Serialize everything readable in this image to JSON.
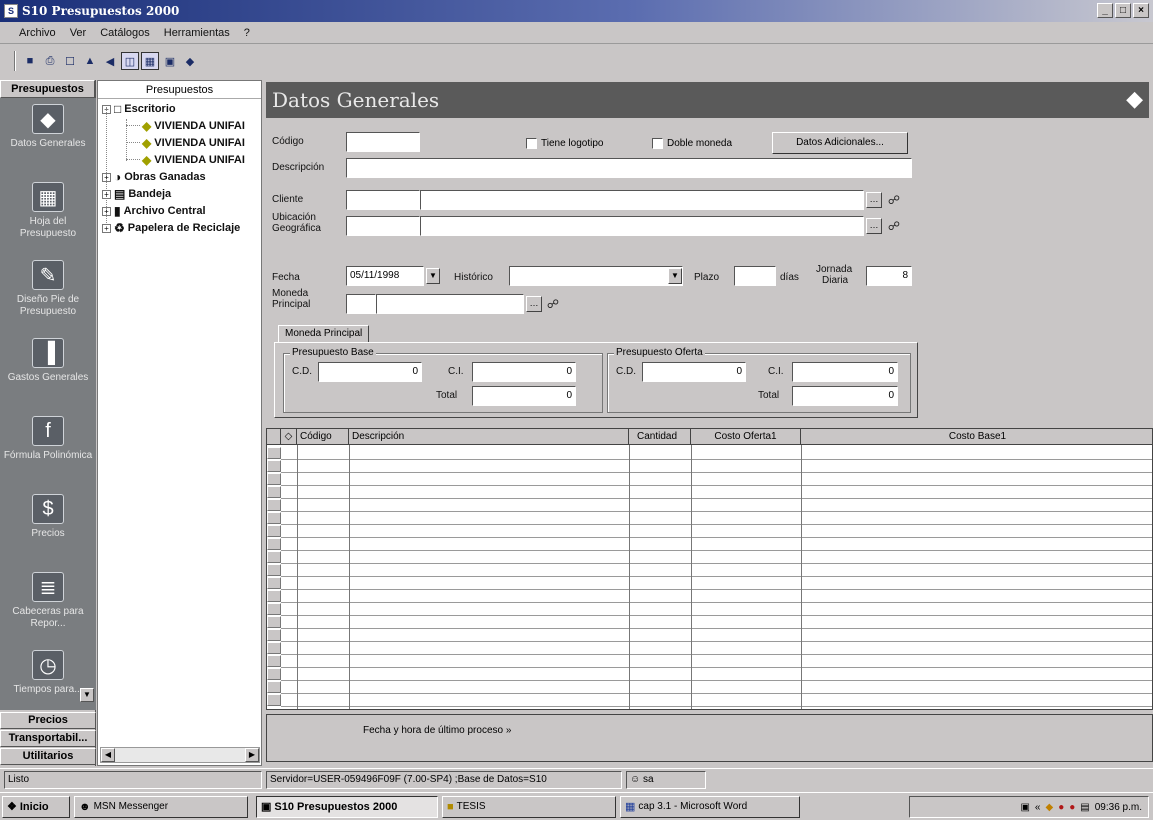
{
  "window": {
    "title": "S10 Presupuestos 2000",
    "controls": [
      "_",
      "□",
      "×"
    ]
  },
  "menu": [
    "Archivo",
    "Ver",
    "Catálogos",
    "Herramientas",
    "?"
  ],
  "outlook": {
    "header": "Presupuestos",
    "items": [
      {
        "label": "Datos Generales",
        "icon": "tag-icon",
        "glyph": "◆"
      },
      {
        "label": "Hoja del Presupuesto",
        "icon": "worksheet-icon",
        "glyph": "▦"
      },
      {
        "label": "Diseño Pie de Presupuesto",
        "icon": "design-icon",
        "glyph": "✎"
      },
      {
        "label": "Gastos Generales",
        "icon": "bar-chart-icon",
        "glyph": "▐"
      },
      {
        "label": "Fórmula Polinómica",
        "icon": "fx-icon",
        "glyph": "f"
      },
      {
        "label": "Precios",
        "icon": "prices-icon",
        "glyph": "$"
      },
      {
        "label": "Cabeceras para Repor...",
        "icon": "note-icon",
        "glyph": "≣"
      },
      {
        "label": "Tiempos para...",
        "icon": "clock-icon",
        "glyph": "◷"
      }
    ],
    "categories": [
      "Precios",
      "Transportabil...",
      "Utilitarios"
    ]
  },
  "tree": {
    "header": "Presupuestos",
    "nodes": [
      {
        "label": "Escritorio",
        "expander": "−"
      },
      {
        "label": "VIVIENDA UNIFAI"
      },
      {
        "label": "VIVIENDA UNIFAI"
      },
      {
        "label": "VIVIENDA UNIFAI"
      },
      {
        "label": "Obras Ganadas",
        "expander": "+"
      },
      {
        "label": "Bandeja",
        "expander": "+"
      },
      {
        "label": "Archivo Central",
        "expander": "+"
      },
      {
        "label": "Papelera de Reciclaje",
        "expander": "+"
      }
    ]
  },
  "main": {
    "title": "Datos Generales",
    "labels": {
      "codigo": "Código",
      "descripcion": "Descripción",
      "cliente": "Cliente",
      "ubicacion": "Ubicación",
      "geografica": "Geográfica",
      "fecha": "Fecha",
      "historico": "Histórico",
      "plazo": "Plazo",
      "dias": "días",
      "jornada": "Jornada",
      "diaria": "Diaria",
      "moneda": "Moneda",
      "principal": "Principal"
    },
    "tiene_logotipo": "Tiene logotipo",
    "doble_moneda": "Doble moneda",
    "datos_adicionales": "Datos Adicionales...",
    "fecha_value": "05/11/1998",
    "jornada_value": "8",
    "tab_label": "Moneda Principal",
    "presupuesto_base": {
      "title": "Presupuesto Base",
      "cd_label": "C.D.",
      "ci_label": "C.I.",
      "total_label": "Total",
      "cd": "0",
      "ci": "0",
      "total": "0"
    },
    "presupuesto_oferta": {
      "title": "Presupuesto Oferta",
      "cd_label": "C.D.",
      "ci_label": "C.I.",
      "total_label": "Total",
      "cd": "0",
      "ci": "0",
      "total": "0"
    }
  },
  "grid": {
    "columns": [
      "◇",
      "Código",
      "Descripción",
      "Cantidad",
      "Costo Oferta1",
      "Costo Base1"
    ]
  },
  "process": {
    "label": "Fecha y hora de último proceso »"
  },
  "status": {
    "ready": "Listo",
    "server": "Servidor=USER-059496F09F (7.00-SP4) ;Base de Datos=S10",
    "user": "sa"
  },
  "taskbar": {
    "start": "Inicio",
    "tasks": [
      "MSN Messenger",
      "S10 Presupuestos 2000",
      "TESIS",
      "cap 3.1 - Microsoft Word"
    ],
    "clock": "09:36 p.m."
  }
}
